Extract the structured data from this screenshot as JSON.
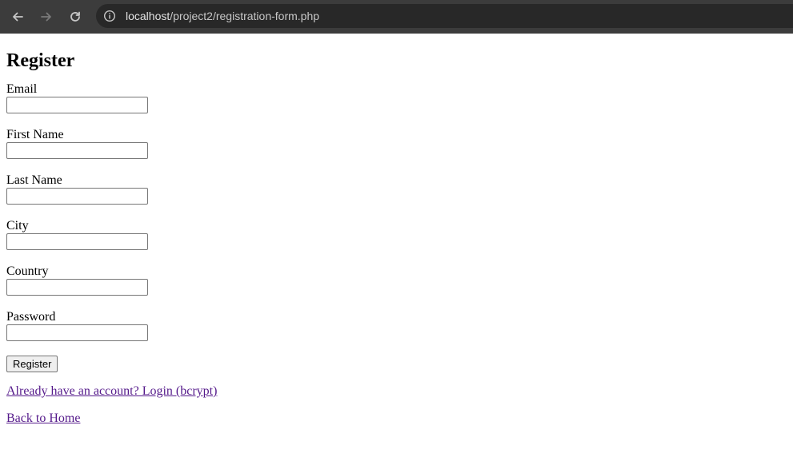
{
  "browser": {
    "url_host": "localhost",
    "url_path": "/project2/registration-form.php",
    "back_icon": "arrow-left-icon",
    "forward_icon": "arrow-right-icon",
    "reload_icon": "reload-icon",
    "site_info_icon": "info-icon"
  },
  "page": {
    "title": "Register",
    "fields": [
      {
        "label": "Email",
        "value": "",
        "placeholder": ""
      },
      {
        "label": "First Name",
        "value": "",
        "placeholder": ""
      },
      {
        "label": "Last Name",
        "value": "",
        "placeholder": ""
      },
      {
        "label": "City",
        "value": "",
        "placeholder": ""
      },
      {
        "label": "Country",
        "value": "",
        "placeholder": ""
      },
      {
        "label": "Password",
        "value": "",
        "placeholder": ""
      }
    ],
    "submit_label": "Register",
    "login_link": "Already have an account? Login (bcrypt)",
    "home_link": "Back to Home"
  },
  "colors": {
    "chrome_bg": "#3c3c3c",
    "omnibox_bg": "#282828",
    "visited_link": "#551a8b"
  }
}
